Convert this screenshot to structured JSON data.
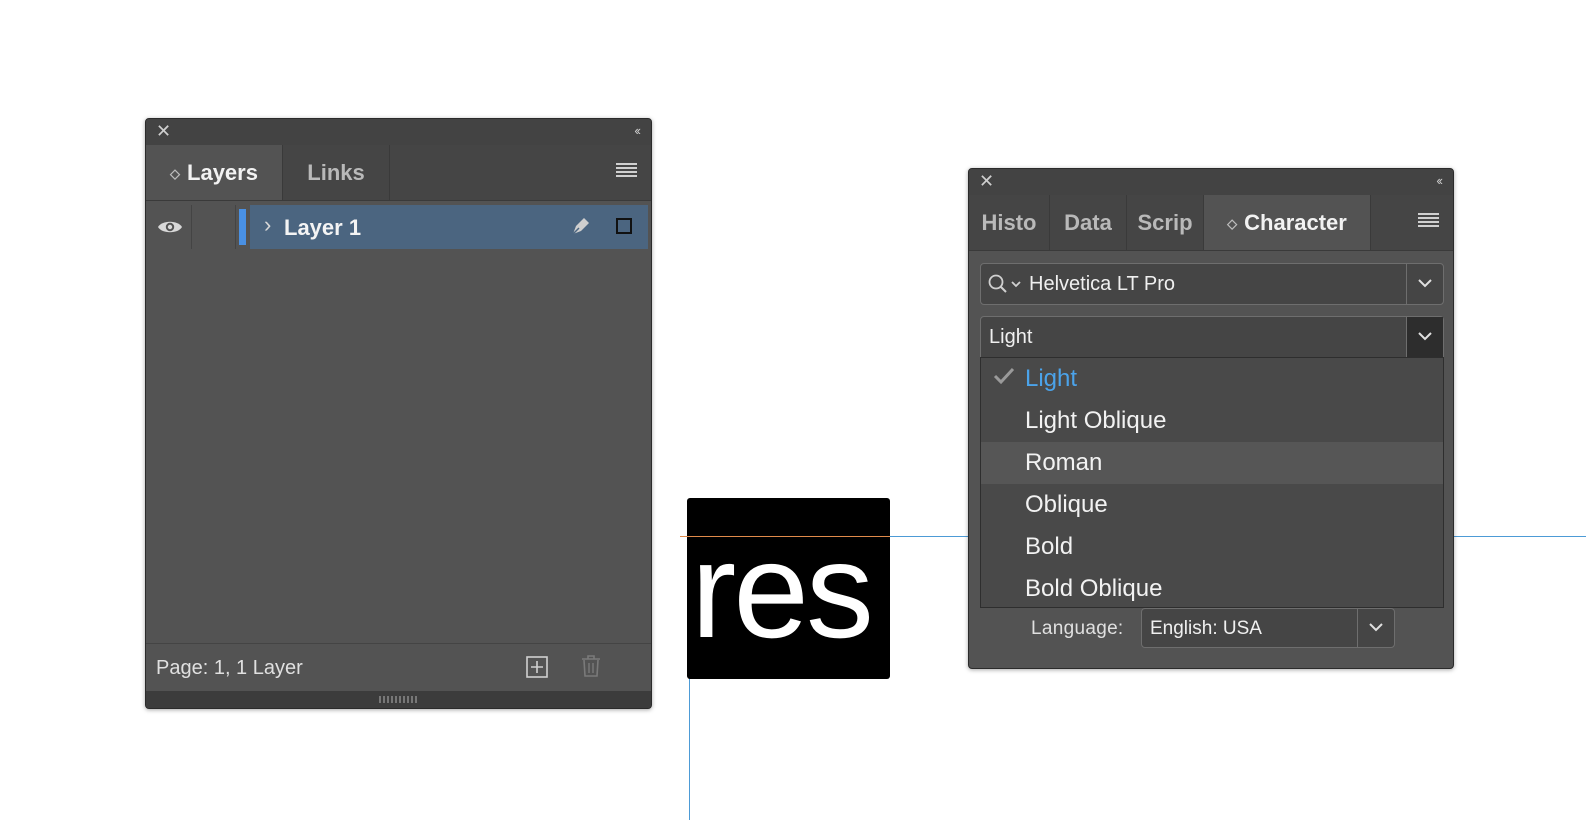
{
  "canvas": {
    "text_frame_text": "res"
  },
  "layers_panel": {
    "tabs": [
      {
        "label": "Layers",
        "active": true
      },
      {
        "label": "Links",
        "active": false
      }
    ],
    "layers": [
      {
        "name": "Layer 1",
        "visible": true,
        "selected": true,
        "color": "#4a90e2"
      }
    ],
    "footer_status": "Page: 1, 1 Layer"
  },
  "character_panel": {
    "tabs": [
      {
        "label": "Histo",
        "active": false
      },
      {
        "label": "Data",
        "active": false
      },
      {
        "label": "Scrip",
        "active": false
      },
      {
        "label": "Character",
        "active": true
      }
    ],
    "font_family": "Helvetica LT Pro",
    "font_style": "Light",
    "style_options": [
      {
        "label": "Light",
        "selected": true
      },
      {
        "label": "Light Oblique",
        "selected": false
      },
      {
        "label": "Roman",
        "selected": false,
        "hovered": true
      },
      {
        "label": "Oblique",
        "selected": false
      },
      {
        "label": "Bold",
        "selected": false
      },
      {
        "label": "Bold Oblique",
        "selected": false
      }
    ],
    "language_label": "Language:",
    "language_value": "English: USA"
  },
  "colors": {
    "panel_bg": "#535353",
    "selection_row": "#4b6580",
    "selected_option_text": "#4ba3ea",
    "guide_line": "#4d9bd6"
  }
}
